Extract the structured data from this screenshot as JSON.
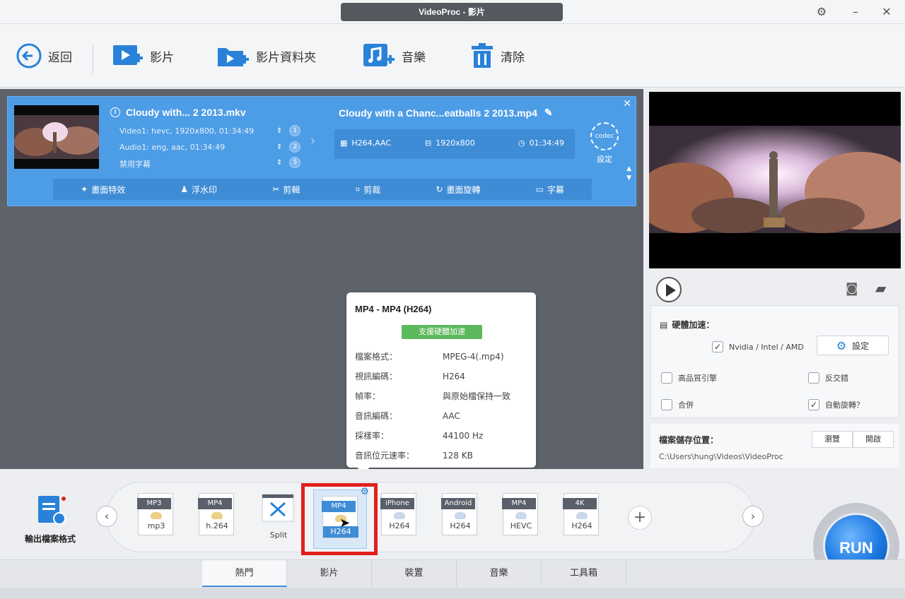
{
  "window": {
    "title": "VideoProc - 影片",
    "controls": [
      "gear-icon",
      "minimize-icon",
      "close-icon"
    ]
  },
  "toolbar": {
    "back_label": "返回",
    "video_label": "影片",
    "video_folder_label": "影片資料夾",
    "music_label": "音樂",
    "clear_label": "清除"
  },
  "video_card": {
    "source_title": "Cloudy with... 2 2013.mkv",
    "source_lines": [
      {
        "text": "Video1: hevc, 1920x800, 01:34:49",
        "index": "1"
      },
      {
        "text": "Audio1: eng, aac, 01:34:49",
        "index": "2"
      },
      {
        "text": "禁用字幕",
        "index": "5"
      }
    ],
    "dest_title": "Cloudy with a Chanc...eatballs 2 2013.mp4",
    "dest_codec": "H264,AAC",
    "dest_resolution": "1920x800",
    "dest_duration": "01:34:49",
    "codec_label": "設定",
    "codec_icon_text": "codec",
    "edit_buttons": [
      "畫面特效",
      "浮水印",
      "剪輯",
      "剪裁",
      "畫面旋轉",
      "字幕"
    ]
  },
  "tooltip": {
    "title": "MP4 - MP4 (H264)",
    "badge": "支援硬體加速",
    "rows": [
      {
        "label": "檔案格式：",
        "value": "MPEG-4(.mp4)"
      },
      {
        "label": "視訊編碼：",
        "value": "H264"
      },
      {
        "label": "幀率：",
        "value": "與原始檔保持一致"
      },
      {
        "label": "音訊編碼：",
        "value": "AAC"
      },
      {
        "label": "採樣率：",
        "value": "44100 Hz"
      },
      {
        "label": "音訊位元速率：",
        "value": "128 KB"
      }
    ]
  },
  "hw_panel": {
    "title": "硬體加速：",
    "nvidia_label": "Nvidia / Intel / AMD",
    "nvidia_checked": true,
    "settings_label": "設定",
    "options": [
      {
        "label": "高品質引擎",
        "checked": false
      },
      {
        "label": "反交錯",
        "checked": false
      },
      {
        "label": "合併",
        "checked": false
      },
      {
        "label": "自動旋轉？",
        "checked": true
      }
    ]
  },
  "output": {
    "label": "檔案儲存位置：",
    "path": "C:\\Users\\hung\\Videos\\VideoProc",
    "browse_label": "瀏覽",
    "open_label": "開啟"
  },
  "format_bar": {
    "output_format_label": "輸出檔案格式",
    "items": [
      {
        "tag": "MP3",
        "sub": "mp3"
      },
      {
        "tag": "MP4",
        "sub": "h.264"
      },
      {
        "tag": "",
        "sub": "Split"
      },
      {
        "tag": "MP4",
        "sub": "H264"
      },
      {
        "tag": "iPhone",
        "sub": "H264"
      },
      {
        "tag": "Android",
        "sub": "H264"
      },
      {
        "tag": "MP4",
        "sub": "HEVC"
      },
      {
        "tag": "4K",
        "sub": "H264"
      }
    ],
    "selected_index": 3,
    "run_label": "RUN"
  },
  "tabs": [
    "熱門",
    "影片",
    "裝置",
    "音樂",
    "工具箱"
  ],
  "active_tab": 0,
  "colors": {
    "accent": "#4d9de6",
    "highlight": "#e0201c",
    "badge_green": "#5cb85c"
  }
}
